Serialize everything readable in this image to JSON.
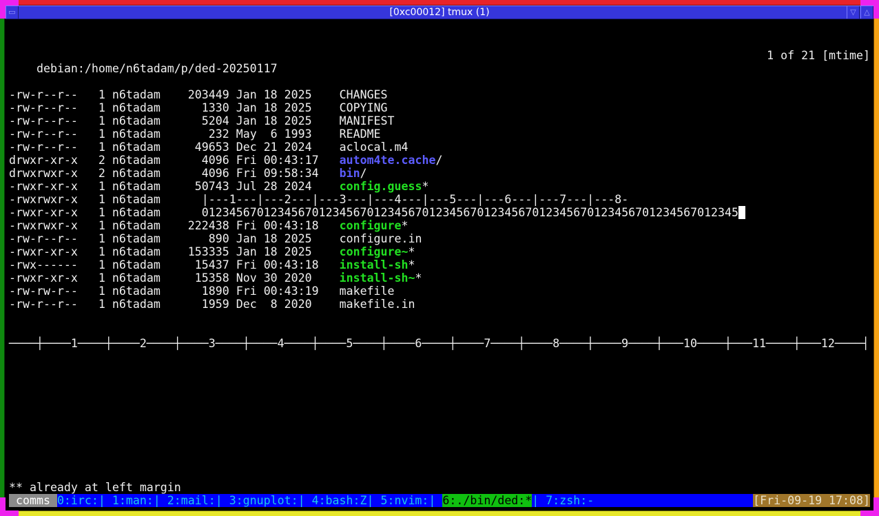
{
  "window": {
    "title": "[0xc00012] tmux (1)",
    "menu_icon": "window-menu-icon",
    "min_icon": "minimize-icon",
    "max_icon": "maximize-icon"
  },
  "header": {
    "path": "debian:/home/n6tadam/p/ded-20250117",
    "position": "1 of 21 [mtime]"
  },
  "files": [
    {
      "perms": "-rw-r--r--",
      "links": "1",
      "owner": "n6tadam",
      "size": "203449",
      "date": "Jan 18 2025",
      "name": "CHANGES",
      "kind": "file",
      "suffix": ""
    },
    {
      "perms": "-rw-r--r--",
      "links": "1",
      "owner": "n6tadam",
      "size": "1330",
      "date": "Jan 18 2025",
      "name": "COPYING",
      "kind": "file",
      "suffix": ""
    },
    {
      "perms": "-rw-r--r--",
      "links": "1",
      "owner": "n6tadam",
      "size": "5204",
      "date": "Jan 18 2025",
      "name": "MANIFEST",
      "kind": "file",
      "suffix": ""
    },
    {
      "perms": "-rw-r--r--",
      "links": "1",
      "owner": "n6tadam",
      "size": "232",
      "date": "May  6 1993",
      "name": "README",
      "kind": "file",
      "suffix": ""
    },
    {
      "perms": "-rw-r--r--",
      "links": "1",
      "owner": "n6tadam",
      "size": "49653",
      "date": "Dec 21 2024",
      "name": "aclocal.m4",
      "kind": "file",
      "suffix": ""
    },
    {
      "perms": "drwxr-xr-x",
      "links": "2",
      "owner": "n6tadam",
      "size": "4096",
      "date": "Fri 00:43:17",
      "name": "autom4te.cache",
      "kind": "dir",
      "suffix": "/"
    },
    {
      "perms": "drwxrwxr-x",
      "links": "2",
      "owner": "n6tadam",
      "size": "4096",
      "date": "Fri 09:58:34",
      "name": "bin",
      "kind": "dir",
      "suffix": "/"
    },
    {
      "perms": "-rwxr-xr-x",
      "links": "1",
      "owner": "n6tadam",
      "size": "50743",
      "date": "Jul 28 2024",
      "name": "config.guess",
      "kind": "exe",
      "suffix": "*"
    },
    {
      "perms": "-rwxrwxr-x",
      "links": "1",
      "owner": "n6tadam",
      "text": "|---1---|---2---|---3---|---4---|---5---|---6---|---7---|---8-"
    },
    {
      "perms": "-rwxr-xr-x",
      "links": "1",
      "owner": "n6tadam",
      "text": "012345670123456701234567012345670123456701234567012345670123456701234567012345",
      "cursor": true
    },
    {
      "perms": "-rwxrwxr-x",
      "links": "1",
      "owner": "n6tadam",
      "size": "222438",
      "date": "Fri 00:43:18",
      "name": "configure",
      "kind": "exe",
      "suffix": "*"
    },
    {
      "perms": "-rw-r--r--",
      "links": "1",
      "owner": "n6tadam",
      "size": "890",
      "date": "Jan 18 2025",
      "name": "configure.in",
      "kind": "file",
      "suffix": ""
    },
    {
      "perms": "-rwxr-xr-x",
      "links": "1",
      "owner": "n6tadam",
      "size": "153335",
      "date": "Jan 18 2025",
      "name": "configure~",
      "kind": "exe",
      "suffix": "*"
    },
    {
      "perms": "-rwx------",
      "links": "1",
      "owner": "n6tadam",
      "size": "15437",
      "date": "Fri 00:43:18",
      "name": "install-sh",
      "kind": "exe",
      "suffix": "*"
    },
    {
      "perms": "-rwxr-xr-x",
      "links": "1",
      "owner": "n6tadam",
      "size": "15358",
      "date": "Nov 30 2020",
      "name": "install-sh~",
      "kind": "exe",
      "suffix": "*"
    },
    {
      "perms": "-rw-rw-r--",
      "links": "1",
      "owner": "n6tadam",
      "size": "1890",
      "date": "Fri 00:43:19",
      "name": "makefile",
      "kind": "file",
      "suffix": ""
    },
    {
      "perms": "-rw-r--r--",
      "links": "1",
      "owner": "n6tadam",
      "size": "1959",
      "date": "Dec  8 2020",
      "name": "makefile.in",
      "kind": "file",
      "suffix": ""
    }
  ],
  "ruler": "────┼────1────┼────2────┼────3────┼────4────┼────5────┼────6────┼────7────┼────8────┼────9────┼───10────┼───11────┼───12────┤",
  "message": "** already at left margin",
  "statusbar": {
    "session": " comms ",
    "windows_before": "0:irc:| 1:man:| 2:mail:| 3:gnuplot:| 4:bash:Z| 5:nvim:| ",
    "current": "6:./bin/ded:*",
    "windows_after": "| 7:zsh:-",
    "clock": "[Fri-09-19 17:08]"
  },
  "colors": {
    "dir": "#5c5cff",
    "exe": "#22e022",
    "status_bg": "#0000ff",
    "clock_bg": "#a0762a"
  }
}
